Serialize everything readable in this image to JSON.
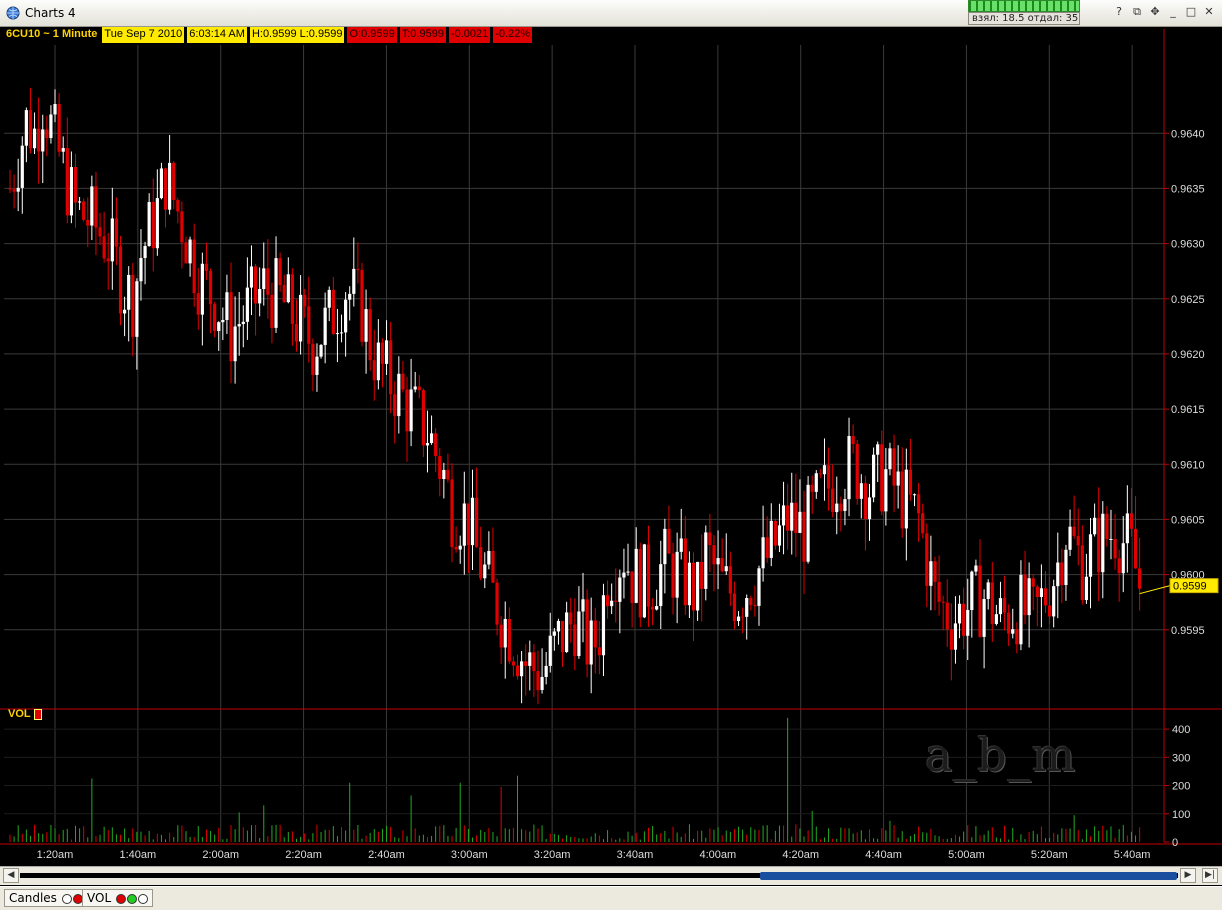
{
  "window": {
    "title": "Charts 4",
    "stats_text": "взял: 18.5 отдал: 35"
  },
  "header": {
    "symbol": "6CU10 ~ 1 Minute",
    "date": "Tue Sep 7 2010",
    "time": "6:03:14 AM",
    "hl": "H:0.9599  L:0.9599",
    "open": "O:0.9599",
    "last": "T:0.9599",
    "change": "-0.0021",
    "change_pct": "-0.22%"
  },
  "volume_label": "VOL",
  "watermark": "a_b_m",
  "tabs": [
    {
      "label": "Candles"
    },
    {
      "label": "VOL"
    }
  ],
  "colors": {
    "up": "#ffffff",
    "down": "#e00000",
    "grid": "#3a3a3a",
    "axis": "#c00000",
    "vol": "#22aa22",
    "price_tag": "#ffea00"
  },
  "chart_data": {
    "type": "candlestick",
    "interval": "1 Minute",
    "x_tick_labels": [
      "1:20am",
      "1:40am",
      "2:00am",
      "2:20am",
      "2:40am",
      "3:00am",
      "3:20am",
      "3:40am",
      "4:00am",
      "4:20am",
      "4:40am",
      "5:00am",
      "5:20am",
      "5:40am"
    ],
    "y_tick_labels": [
      "0.9640",
      "0.9635",
      "0.9630",
      "0.9625",
      "0.9620",
      "0.9615",
      "0.9610",
      "0.9605",
      "0.9600",
      "0.9595"
    ],
    "ylim": [
      0.9588,
      0.9648
    ],
    "last_price": "0.9599",
    "close_path": [
      [
        0,
        0.9635
      ],
      [
        2,
        0.9638
      ],
      [
        4,
        0.9641
      ],
      [
        6,
        0.964
      ],
      [
        8,
        0.9643
      ],
      [
        12,
        0.9638
      ],
      [
        16,
        0.9633
      ],
      [
        20,
        0.9632
      ],
      [
        24,
        0.963
      ],
      [
        28,
        0.9626
      ],
      [
        30,
        0.9625
      ],
      [
        32,
        0.9629
      ],
      [
        36,
        0.9633
      ],
      [
        38,
        0.9636
      ],
      [
        42,
        0.9632
      ],
      [
        46,
        0.9627
      ],
      [
        50,
        0.9625
      ],
      [
        54,
        0.9622
      ],
      [
        58,
        0.9624
      ],
      [
        62,
        0.9626
      ],
      [
        66,
        0.9625
      ],
      [
        70,
        0.9623
      ],
      [
        74,
        0.9621
      ],
      [
        78,
        0.9623
      ],
      [
        82,
        0.9626
      ],
      [
        86,
        0.9624
      ],
      [
        88,
        0.9621
      ],
      [
        90,
        0.9619
      ],
      [
        94,
        0.9617
      ],
      [
        96,
        0.9616
      ],
      [
        98,
        0.9615
      ],
      [
        102,
        0.9613
      ],
      [
        104,
        0.9611
      ],
      [
        106,
        0.9609
      ],
      [
        108,
        0.9606
      ],
      [
        112,
        0.9605
      ],
      [
        114,
        0.9602
      ],
      [
        118,
        0.9598
      ],
      [
        122,
        0.9595
      ],
      [
        126,
        0.9592
      ],
      [
        130,
        0.9591
      ],
      [
        134,
        0.9594
      ],
      [
        138,
        0.9596
      ],
      [
        142,
        0.9593
      ],
      [
        144,
        0.9595
      ],
      [
        146,
        0.96
      ],
      [
        150,
        0.9602
      ],
      [
        152,
        0.96
      ],
      [
        156,
        0.9599
      ],
      [
        160,
        0.9601
      ],
      [
        164,
        0.96
      ],
      [
        168,
        0.9598
      ],
      [
        170,
        0.9602
      ],
      [
        174,
        0.9599
      ],
      [
        178,
        0.9598
      ],
      [
        182,
        0.96
      ],
      [
        186,
        0.9602
      ],
      [
        190,
        0.9605
      ],
      [
        194,
        0.9604
      ],
      [
        198,
        0.9607
      ],
      [
        202,
        0.9609
      ],
      [
        206,
        0.961
      ],
      [
        210,
        0.9608
      ],
      [
        214,
        0.9609
      ],
      [
        218,
        0.9607
      ],
      [
        222,
        0.9605
      ],
      [
        226,
        0.9598
      ],
      [
        230,
        0.9596
      ],
      [
        234,
        0.9597
      ],
      [
        238,
        0.9598
      ],
      [
        242,
        0.9596
      ],
      [
        246,
        0.9597
      ],
      [
        250,
        0.9596
      ],
      [
        254,
        0.9599
      ],
      [
        256,
        0.9601
      ],
      [
        258,
        0.9604
      ],
      [
        262,
        0.9601
      ],
      [
        266,
        0.9603
      ],
      [
        270,
        0.9604
      ],
      [
        274,
        0.9602
      ],
      [
        276,
        0.9599
      ]
    ],
    "volume": {
      "y_tick_labels": [
        "400",
        "300",
        "200",
        "100",
        "0"
      ],
      "ylim": [
        0,
        450
      ],
      "spikes": [
        [
          20,
          225
        ],
        [
          56,
          105
        ],
        [
          62,
          130
        ],
        [
          83,
          210
        ],
        [
          98,
          165
        ],
        [
          110,
          210
        ],
        [
          120,
          195
        ],
        [
          124,
          235
        ],
        [
          190,
          440
        ],
        [
          196,
          110
        ],
        [
          215,
          75
        ],
        [
          260,
          95
        ]
      ]
    }
  }
}
